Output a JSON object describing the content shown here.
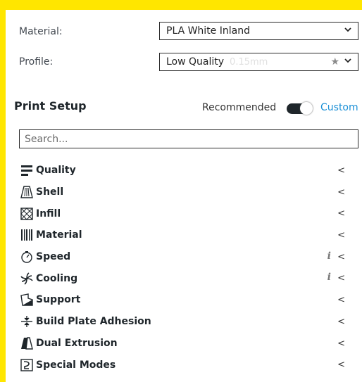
{
  "material": {
    "label": "Material:",
    "value": "PLA White Inland"
  },
  "profile": {
    "label": "Profile:",
    "value": "Low Quality",
    "detail": "0.15mm",
    "star": "★"
  },
  "print_setup": {
    "title": "Print Setup",
    "recommended_label": "Recommended",
    "custom_label": "Custom",
    "toggle_state": "custom"
  },
  "search": {
    "placeholder": "Search..."
  },
  "categories": [
    {
      "label": "Quality",
      "icon": "quality-icon",
      "info": false,
      "arrow": "<"
    },
    {
      "label": "Shell",
      "icon": "shell-icon",
      "info": false,
      "arrow": "<"
    },
    {
      "label": "Infill",
      "icon": "infill-icon",
      "info": false,
      "arrow": "<"
    },
    {
      "label": "Material",
      "icon": "material-icon",
      "info": false,
      "arrow": "<"
    },
    {
      "label": "Speed",
      "icon": "speed-icon",
      "info": true,
      "info_glyph": "i",
      "arrow": "<"
    },
    {
      "label": "Cooling",
      "icon": "cooling-icon",
      "info": true,
      "info_glyph": "i",
      "arrow": "<"
    },
    {
      "label": "Support",
      "icon": "support-icon",
      "info": false,
      "arrow": "<"
    },
    {
      "label": "Build Plate Adhesion",
      "icon": "adhesion-icon",
      "info": false,
      "arrow": "<"
    },
    {
      "label": "Dual Extrusion",
      "icon": "dual-extrusion-icon",
      "info": false,
      "arrow": "<"
    },
    {
      "label": "Special Modes",
      "icon": "special-modes-icon",
      "info": false,
      "arrow": "<"
    }
  ],
  "colors": {
    "background": "#FFE600",
    "accent": "#1a8fd6",
    "text": "#1f262b"
  }
}
